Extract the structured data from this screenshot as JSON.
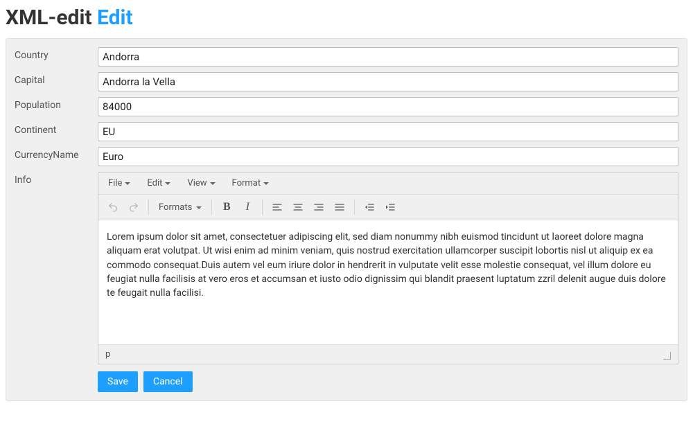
{
  "title": {
    "app": "XML-edit",
    "page": "Edit"
  },
  "fields": {
    "country": {
      "label": "Country",
      "value": "Andorra"
    },
    "capital": {
      "label": "Capital",
      "value": "Andorra la Vella"
    },
    "population": {
      "label": "Population",
      "value": "84000"
    },
    "continent": {
      "label": "Continent",
      "value": "EU"
    },
    "currencyName": {
      "label": "CurrencyName",
      "value": "Euro"
    },
    "info": {
      "label": "Info"
    }
  },
  "editor": {
    "menu": {
      "file": "File",
      "edit": "Edit",
      "view": "View",
      "format": "Format"
    },
    "toolbar": {
      "formats": "Formats"
    },
    "content": "Lorem ipsum dolor sit amet, consectetuer adipiscing elit, sed diam nonummy nibh euismod tincidunt ut laoreet dolore magna aliquam erat volutpat. Ut wisi enim ad minim veniam, quis nostrud exercitation ullamcorper suscipit lobortis nisl ut aliquip ex ea commodo consequat.Duis autem vel eum iriure dolor in hendrerit in vulputate velit esse molestie consequat, vel illum dolore eu feugiat nulla facilisis at vero eros et accumsan et iusto odio dignissim qui blandit praesent luptatum zzril delenit augue duis dolore te feugait nulla facilisi.",
    "statusPath": "p"
  },
  "buttons": {
    "save": "Save",
    "cancel": "Cancel"
  }
}
